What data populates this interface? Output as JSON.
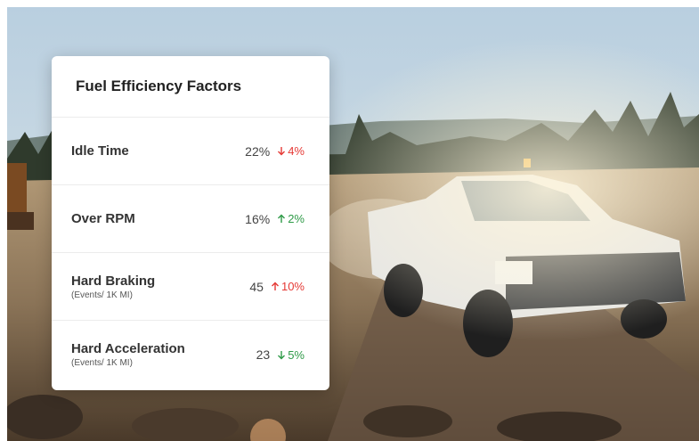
{
  "card": {
    "title": "Fuel Efficiency Factors",
    "rows": [
      {
        "label": "Idle Time",
        "sublabel": "",
        "value": "22%",
        "change": "4%",
        "direction": "down",
        "color": "#e53935"
      },
      {
        "label": "Over RPM",
        "sublabel": "",
        "value": "16%",
        "change": "2%",
        "direction": "up",
        "color": "#2e9a47"
      },
      {
        "label": "Hard Braking",
        "sublabel": "(Events/ 1K MI)",
        "value": "45",
        "change": "10%",
        "direction": "up",
        "color": "#e53935"
      },
      {
        "label": "Hard Acceleration",
        "sublabel": "(Events/ 1K MI)",
        "value": "23",
        "change": "5%",
        "direction": "down",
        "color": "#2e9a47"
      }
    ]
  },
  "icons": [
    "arrow-down-icon",
    "arrow-up-icon"
  ]
}
